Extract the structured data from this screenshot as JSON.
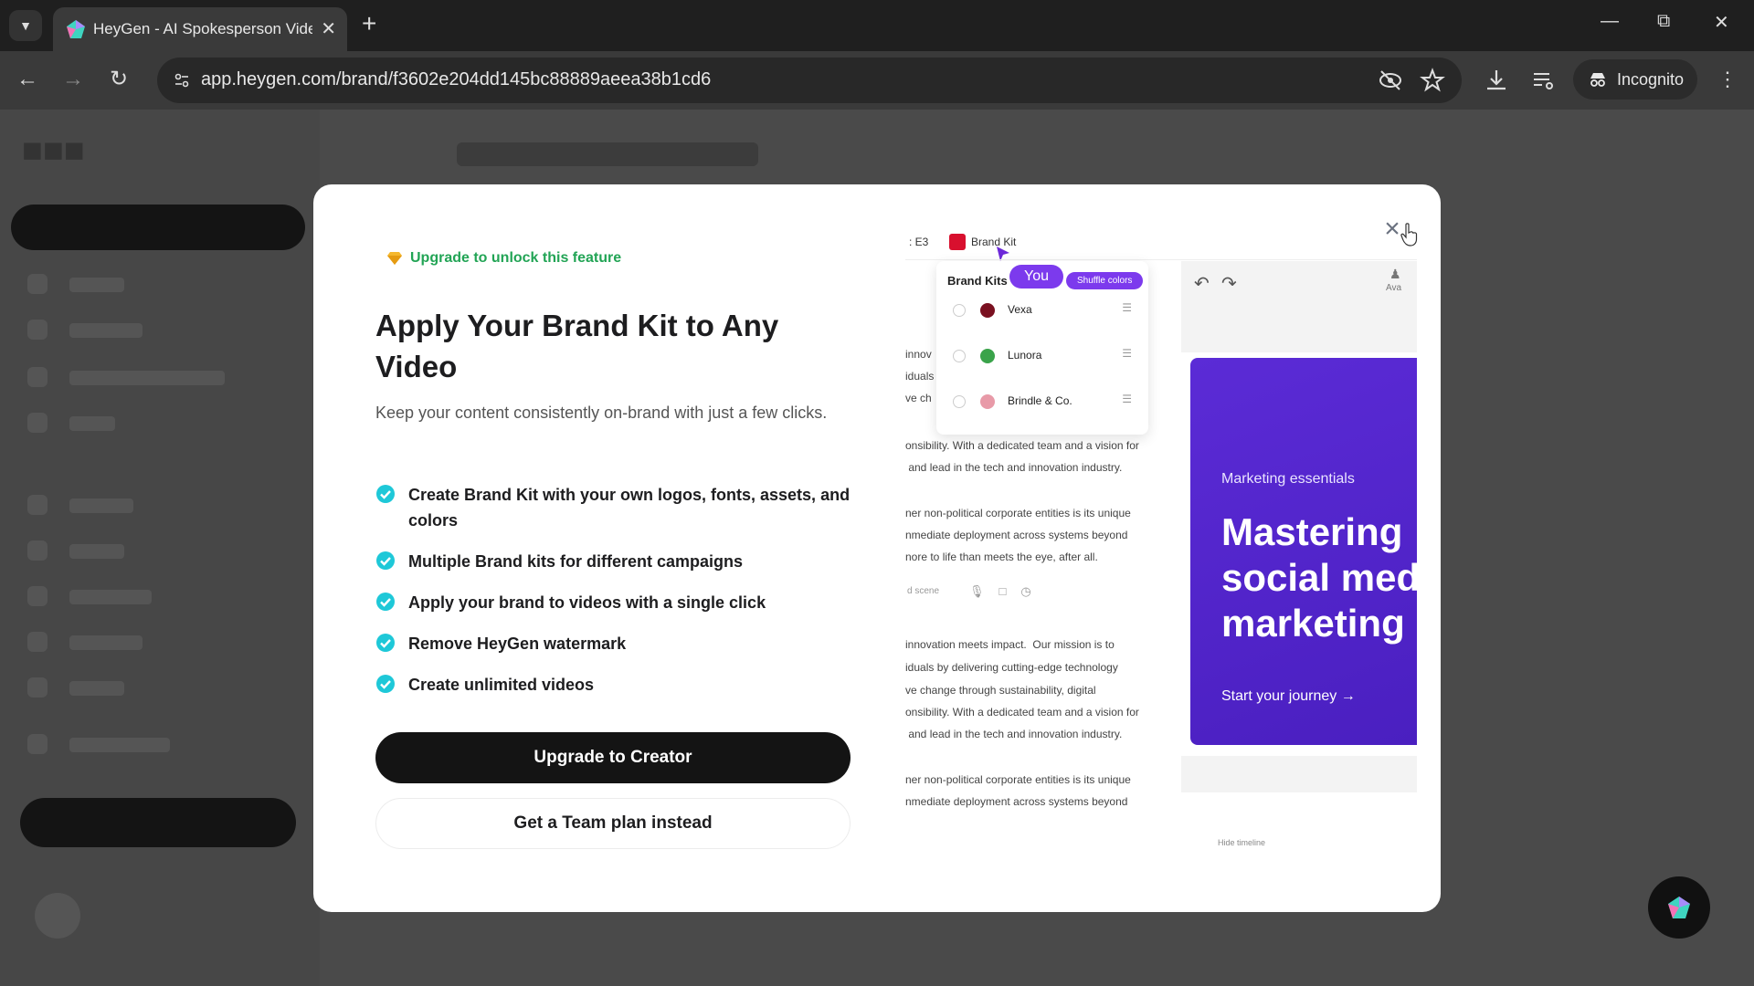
{
  "browser": {
    "tab_title": "HeyGen - AI Spokesperson Vide",
    "url": "app.heygen.com/brand/f3602e204dd145bc88889aeea38b1cd6",
    "incognito_label": "Incognito"
  },
  "modal": {
    "unlock_label": "Upgrade to unlock this feature",
    "title": "Apply Your Brand Kit to Any Video",
    "subtitle": "Keep your content consistently on-brand with just a few clicks.",
    "features": [
      "Create Brand Kit with your own logos, fonts, assets, and colors",
      "Multiple Brand kits for different campaigns",
      "Apply your brand to videos with a single click",
      "Remove HeyGen watermark",
      "Create unlimited videos"
    ],
    "primary_button": "Upgrade to Creator",
    "secondary_button": "Get a Team plan instead"
  },
  "preview": {
    "scene_label": ": E3",
    "brand_kit_label": "Brand Kit",
    "panel_title": "Brand Kits",
    "you_label": "You",
    "shuffle_label": "Shuffle colors",
    "kits": [
      {
        "name": "Vexa",
        "color": "#7a1020"
      },
      {
        "name": "Lunora",
        "color": "#3aa34a"
      },
      {
        "name": "Brindle & Co.",
        "color": "#e89aa8"
      }
    ],
    "avatar_label": "Ava",
    "script_fragments": [
      "innov",
      "iduals",
      "ve ch"
    ],
    "script_block_1": [
      "onsibility. With a dedicated team and a vision for",
      " and lead in the tech and innovation industry.",
      "",
      "ner non-political corporate entities is its unique",
      "nmediate deployment across systems beyond",
      "nore to life than meets the eye, after all."
    ],
    "add_scene_label": "d scene",
    "script_block_2": [
      "innovation meets impact.  Our mission is to",
      "iduals by delivering cutting-edge technology",
      "ve change through sustainability, digital",
      "onsibility. With a dedicated team and a vision for",
      " and lead in the tech and innovation industry.",
      "",
      "ner non-political corporate entities is its unique",
      "nmediate deployment across systems beyond"
    ],
    "card_eyebrow": "Marketing essentials",
    "card_title": "Mastering\nsocial media\nmarketing",
    "card_cta": "Start your journey →",
    "timeline_label": "Hide timeline"
  },
  "colors": {
    "accent_purple": "#7c3aed",
    "success_green": "#22a455",
    "check_teal": "#1ec8d8",
    "primary_button": "#141414"
  }
}
